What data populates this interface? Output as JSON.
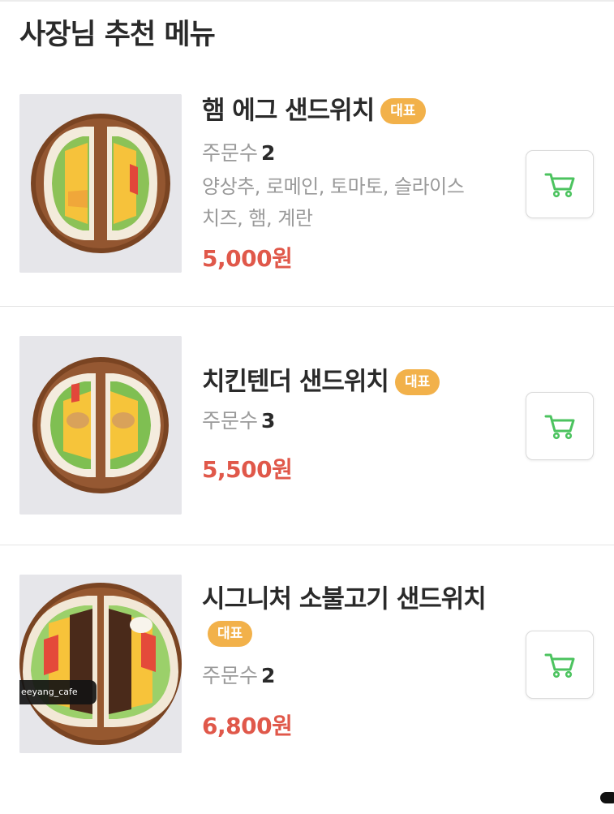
{
  "section_title": "사장님 추천 메뉴",
  "items": [
    {
      "name": "햄 에그 샌드위치",
      "badge": "대표",
      "orders_label": "주문수",
      "orders_count": "2",
      "description_lines": [
        "양상추, 로메인, 토마토, 슬라이스",
        "치즈, 햄, 계란"
      ],
      "price": "5,000원"
    },
    {
      "name": "치킨텐더 샌드위치",
      "badge": "대표",
      "orders_label": "주문수",
      "orders_count": "3",
      "price": "5,500원"
    },
    {
      "name": "시그니처 소불고기 샌드위치",
      "badge": "대표",
      "orders_label": "주문수",
      "orders_count": "2",
      "price": "6,800원",
      "watermark": "eeyang_cafe"
    }
  ],
  "colors": {
    "badge": "#f2b14a",
    "price": "#e0584a",
    "cart_icon": "#4cc35f"
  },
  "icons": {
    "cart": "shopping-cart-icon"
  }
}
